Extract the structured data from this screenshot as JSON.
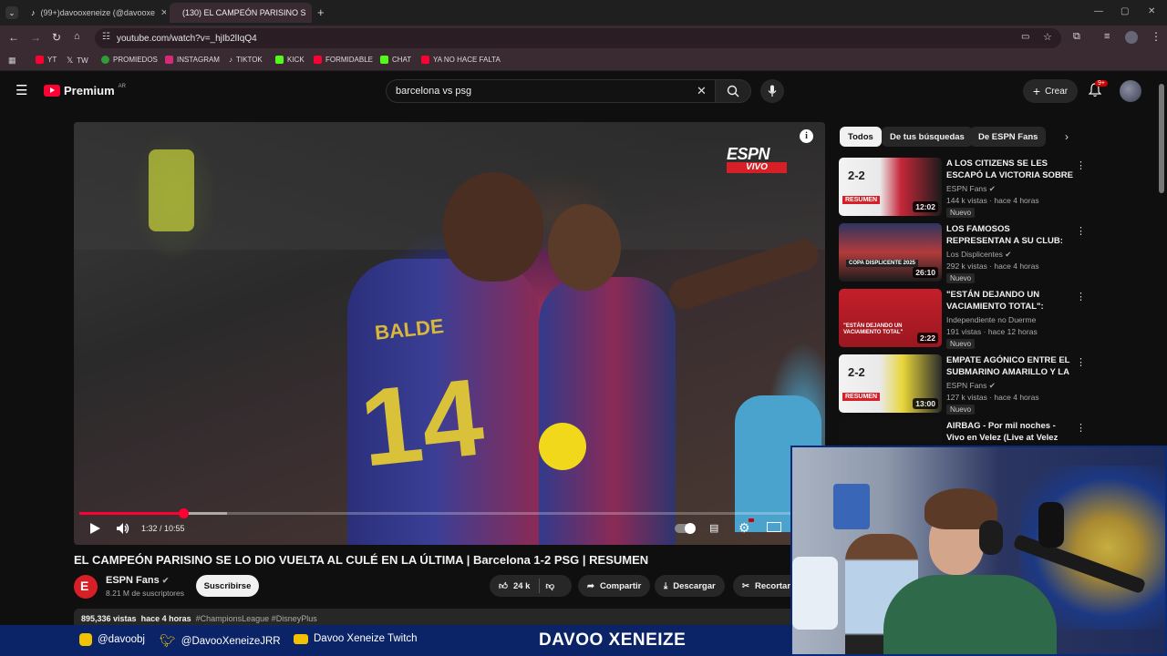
{
  "browser": {
    "tabs": [
      {
        "label": "(99+)davooxeneize (@davooxe",
        "active": false
      },
      {
        "label": "(130) EL CAMPEÓN PARISINO S",
        "active": true
      }
    ],
    "address": "youtube.com/watch?v=_hjIb2lIqQ4",
    "bookmarks": [
      "YT",
      "TW",
      "PROMIEDOS",
      "INSTAGRAM",
      "TIKTOK",
      "KICK",
      "FORMIDABLE",
      "CHAT",
      "YA NO HACE FALTA"
    ]
  },
  "youtube": {
    "logo_text": "Premium",
    "logo_region": "AR",
    "search_query": "barcelona vs psg",
    "create_label": "Crear",
    "notif_count": "9+"
  },
  "player": {
    "broadcast_logo": "ESPN",
    "broadcast_tag": "VIVO",
    "time_current": "1:32",
    "time_total": "10:55",
    "time_readout": "1:32 / 10:55",
    "progress_fraction": 0.14,
    "buffer_fraction": 0.2,
    "player_jersey_name": "BALDE",
    "player_jersey_number": "14"
  },
  "video": {
    "title": "EL CAMPEÓN PARISINO SE LO DIO VUELTA AL CULÉ EN LA ÚLTIMA | Barcelona 1-2 PSG | RESUMEN",
    "channel": "ESPN Fans",
    "subscribers": "8.21 M de suscriptores",
    "subscribe_label": "Suscribirse",
    "likes": "24 k",
    "share_label": "Compartir",
    "download_label": "Descargar",
    "clip_label": "Recortar",
    "views": "895,336 vistas",
    "age": "hace 4 horas",
    "tags": "#ChampionsLeague #DisneyPlus"
  },
  "sidebar": {
    "chips": [
      "Todos",
      "De tus búsquedas",
      "De ESPN Fans"
    ],
    "recommendations": [
      {
        "title": "A LOS CITIZENS SE LES ESCAPÓ LA VICTORIA SOBRE ...",
        "channel": "ESPN Fans",
        "verified": true,
        "stats": "144 k vistas · hace 4 horas",
        "badge": "Nuevo",
        "duration": "12:02",
        "thumb_text": "RESUMEN",
        "thumb_score": "2-2"
      },
      {
        "title": "LOS FAMOSOS REPRESENTAN A SU CLUB: ASÍ ES LA COPA ...",
        "channel": "Los Displicentes",
        "verified": true,
        "stats": "292 k vistas · hace 4 horas",
        "badge": "Nuevo",
        "duration": "26:10",
        "thumb_text": "COPA DISPLICENTE 2025"
      },
      {
        "title": "\"ESTÁN DEJANDO UN VACIAMIENTO TOTAL\": Miguel...",
        "channel": "Independiente no Duerme",
        "verified": false,
        "stats": "191 vistas · hace 12 horas",
        "badge": "Nuevo",
        "duration": "2:22",
        "thumb_text": "\"ESTÁN DEJANDO UN VACIAMIENTO TOTAL\""
      },
      {
        "title": "EMPATE AGÓNICO ENTRE EL SUBMARINO AMARILLO Y LA ...",
        "channel": "ESPN Fans",
        "verified": true,
        "stats": "127 k vistas · hace 4 horas",
        "badge": "Nuevo",
        "duration": "13:00",
        "thumb_text": "RESUMEN",
        "thumb_score": "2-2"
      },
      {
        "title": "AIRBAG - Por mil noches - Vivo en Velez (Live at Velez Stadium)",
        "channel": "",
        "verified": false,
        "stats": "",
        "badge": "",
        "duration": ""
      }
    ]
  },
  "stream_overlay": {
    "instagram": "@davoobj",
    "twitter": "@DavooXeneizeJRR",
    "twitch": "Davoo Xeneize Twitch",
    "brand": "DAVOO XENEIZE"
  },
  "colors": {
    "yt_red": "#ff0033",
    "stream_blue": "#0b2468",
    "espn_red": "#d61f26"
  }
}
